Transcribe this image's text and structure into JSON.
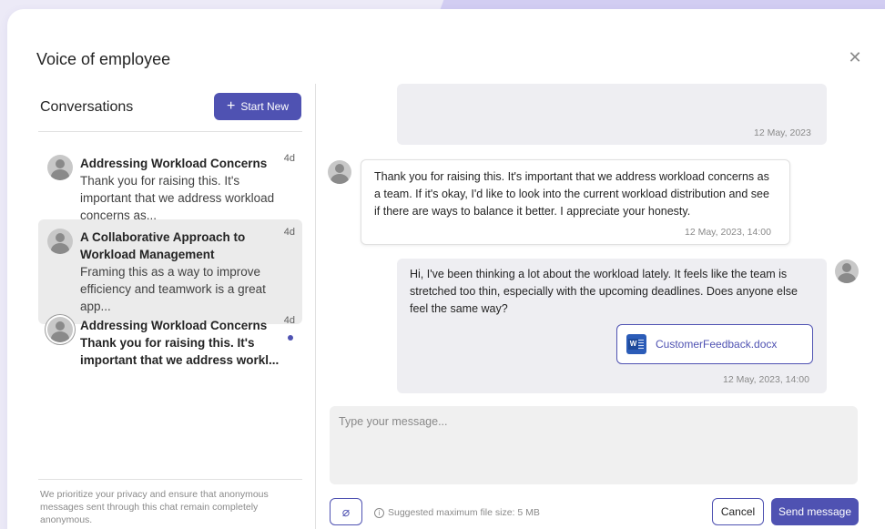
{
  "dialog": {
    "title": "Voice of employee",
    "close_icon": "close-icon"
  },
  "sidebar": {
    "header": "Conversations",
    "start_new_label": "Start New",
    "conversations": [
      {
        "title": "Addressing Workload Concerns",
        "snippet": "Thank you for raising this. It's important that we address workload concerns as...",
        "time": "4d",
        "selected": false,
        "unread": false
      },
      {
        "title": "A Collaborative Approach to Workload Management",
        "snippet": "Framing this as a way to improve efficiency and teamwork is a great app...",
        "time": "4d",
        "selected": true,
        "unread": false
      },
      {
        "title": "Addressing Workload Concerns",
        "snippet": "Thank you for raising this. It's important that we address workl...",
        "time": "4d",
        "selected": false,
        "unread": true
      }
    ],
    "privacy_note": "We prioritize your privacy and ensure that anonymous messages sent through this chat remain completely anonymous."
  },
  "chat": {
    "messages": [
      {
        "sender": "me",
        "text": "",
        "timestamp": "12 May, 2023"
      },
      {
        "sender": "them",
        "text": "Thank you for raising this. It's important that we address workload concerns as a team. If it's okay, I'd like to look into the current workload distribution and see if there are ways to balance it better. I appreciate your honesty.",
        "timestamp": "12 May, 2023, 14:00"
      },
      {
        "sender": "me",
        "text": "Hi, I've been thinking a lot about the workload lately. It feels like the team is stretched too thin, especially with the upcoming deadlines. Does anyone else feel the same way?",
        "timestamp": "12 May, 2023, 14:00",
        "attachment": "CustomerFeedback.docx"
      }
    ]
  },
  "composer": {
    "placeholder": "Type your message...",
    "hint": "Suggested maximum file size: 5 MB",
    "cancel_label": "Cancel",
    "send_label": "Send message"
  },
  "colors": {
    "accent": "#4F52B2",
    "background": "#ECEAF7"
  }
}
